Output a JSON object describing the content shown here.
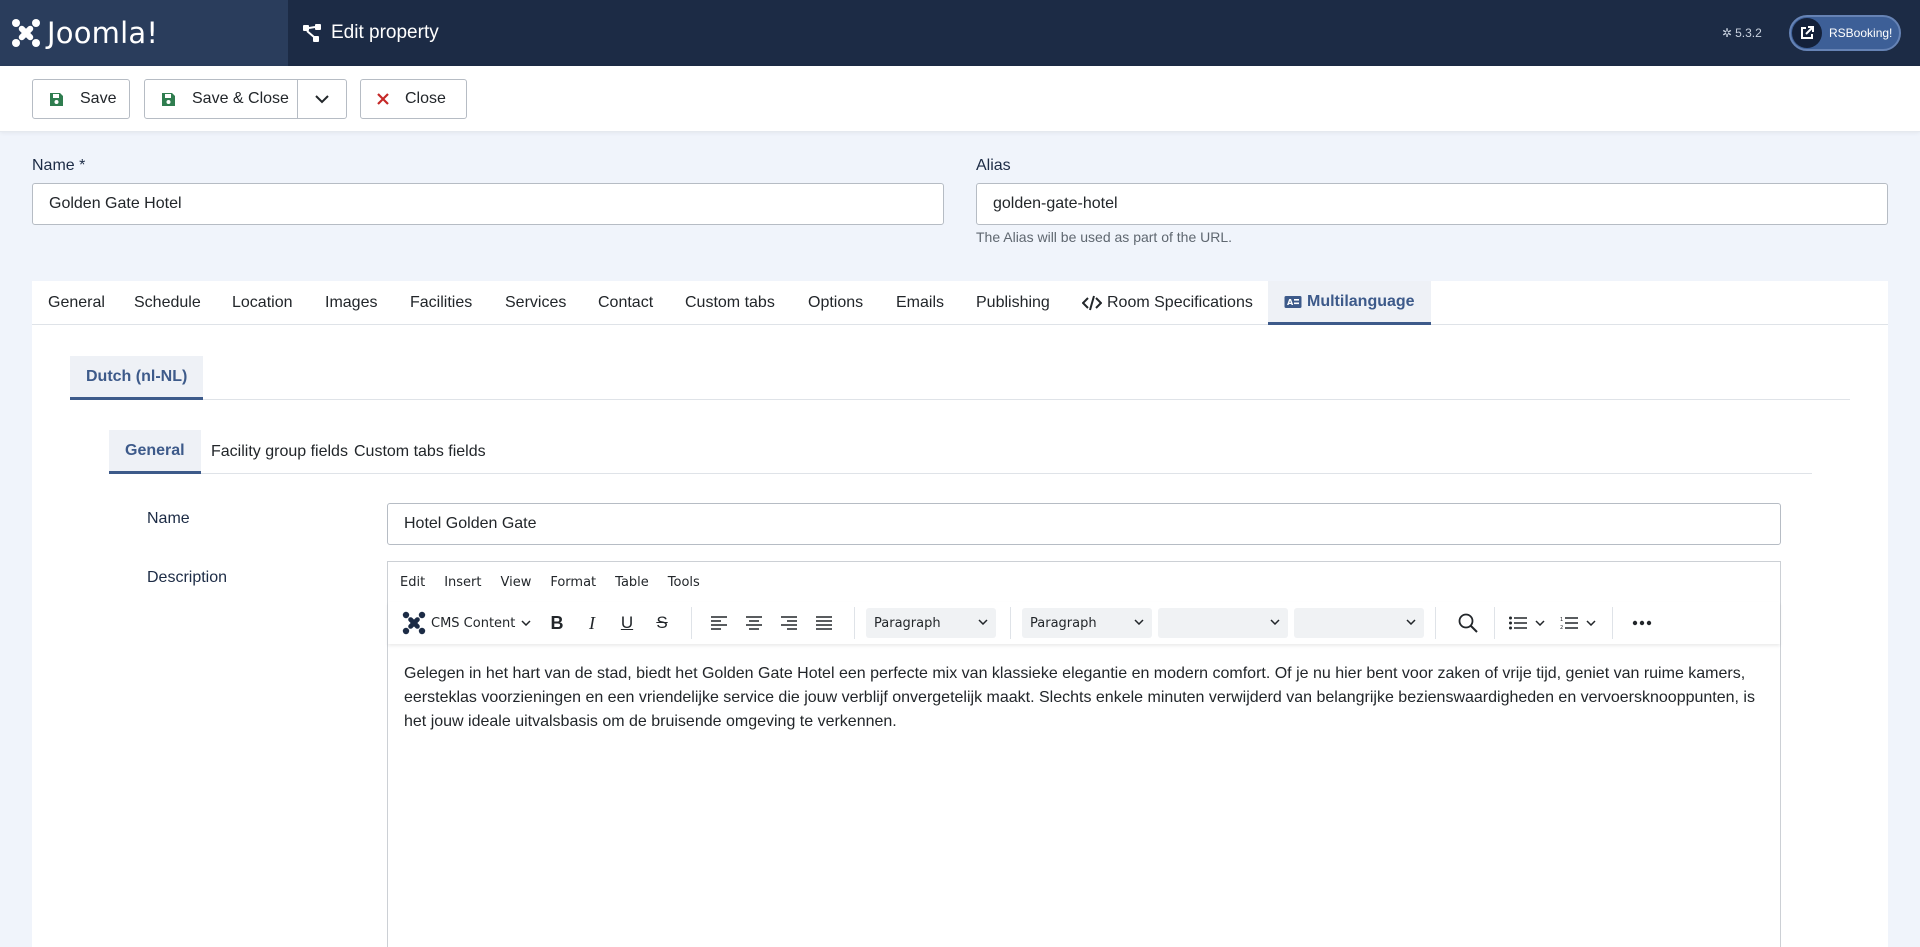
{
  "header": {
    "logo_text": "Joomla!",
    "page_title": "Edit property",
    "version": "5.3.2",
    "user_button": "RSBooking!"
  },
  "toolbar": {
    "save": "Save",
    "save_close": "Save & Close",
    "close": "Close"
  },
  "form": {
    "name_label": "Name *",
    "name_value": "Golden Gate Hotel",
    "alias_label": "Alias",
    "alias_value": "golden-gate-hotel",
    "alias_hint": "The Alias will be used as part of the URL."
  },
  "tabs": [
    "General",
    "Schedule",
    "Location",
    "Images",
    "Facilities",
    "Services",
    "Contact",
    "Custom tabs",
    "Options",
    "Emails",
    "Publishing",
    "Room Specifications",
    "Multilanguage"
  ],
  "active_tab": "Multilanguage",
  "language_tab": "Dutch (nl-NL)",
  "sub_tabs": [
    "General",
    "Facility group fields",
    "Custom tabs fields"
  ],
  "translation": {
    "name_label": "Name",
    "name_value": "Hotel Golden Gate",
    "description_label": "Description"
  },
  "editor": {
    "menu": [
      "Edit",
      "Insert",
      "View",
      "Format",
      "Table",
      "Tools"
    ],
    "cms_content": "CMS Content",
    "block_format_1": "Paragraph",
    "block_format_2": "Paragraph",
    "content": "Gelegen in het hart van de stad, biedt het Golden Gate Hotel een perfecte mix van klassieke elegantie en modern comfort. Of je nu hier bent voor zaken of vrije tijd, geniet van ruime kamers, eersteklas voorzieningen en een vriendelijke service die jouw verblijf onvergetelijk maakt. Slechts enkele minuten verwijderd van belangrijke bezienswaardigheden en vervoersknooppunten, is het jouw ideale uitvalsbasis om de bruisende omgeving te verkennen."
  },
  "colors": {
    "header_bg": "#1c2b45",
    "logo_bg": "#2a3d5c",
    "accent": "#3d5a8a",
    "page_bg": "#f0f4fb",
    "close_icon": "#c52827",
    "save_icon": "#2f7d4f"
  }
}
